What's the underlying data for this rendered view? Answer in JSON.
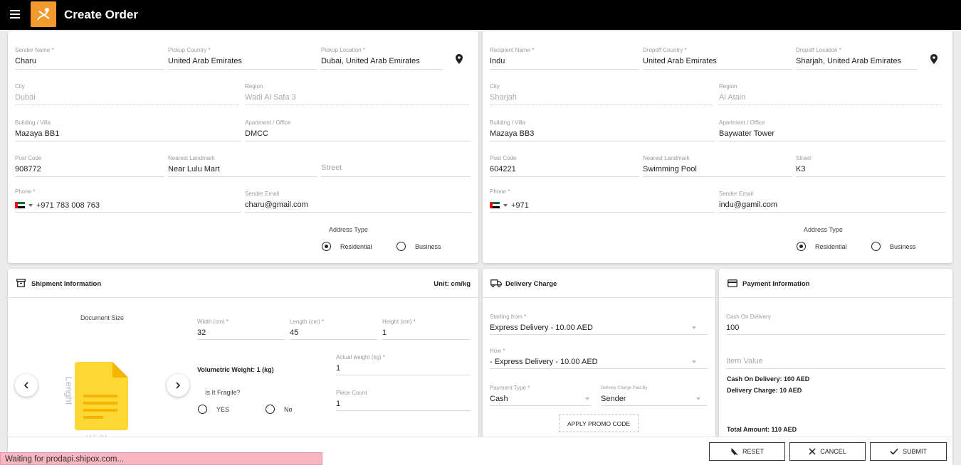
{
  "app": {
    "title": "Create Order"
  },
  "sender": {
    "name_label": "Sender Name *",
    "name": "Charu",
    "country_label": "Pickup Country *",
    "country": "United Arab Emirates",
    "location_label": "Pickup Location *",
    "location": "Dubai, United Arab Emirates",
    "city_label": "City",
    "city": "Dubai",
    "region_label": "Region",
    "region": "Wadi Al Safa 3",
    "building_label": "Building / Villa",
    "building": "Mazaya BB1",
    "apartment_label": "Apartment / Office",
    "apartment": "DMCC",
    "postcode_label": "Post Code",
    "postcode": "908772",
    "landmark_label": "Nearest Landmark",
    "landmark": "Near Lulu Mart",
    "street_placeholder": "Street",
    "phone_label": "Phone *",
    "phone": "+971 783 008 763",
    "email_label": "Sender Email",
    "email": "charu@gmail.com",
    "address_type_label": "Address Type",
    "residential_label": "Residential",
    "business_label": "Business",
    "address_type_selected": "Residential"
  },
  "recipient": {
    "name_label": "Recipient Name *",
    "name": "Indu",
    "country_label": "Dropoff Country *",
    "country": "United Arab Emirates",
    "location_label": "Dropoff Location *",
    "location": "Sharjah, United Arab Emirates",
    "city_label": "City",
    "city": "Sharjah",
    "region_label": "Region",
    "region": "Al Atain",
    "building_label": "Building / Villa",
    "building": "Mazaya BB3",
    "apartment_label": "Apartment / Office",
    "apartment": "Baywater Tower",
    "postcode_label": "Post Code",
    "postcode": "604221",
    "landmark_label": "Nearest Landmark",
    "landmark": "Swimming Pool",
    "street_label": "Street",
    "street": "K3",
    "phone_label": "Phone *",
    "phone": "+971",
    "email_label": "Sender Email",
    "email": "indu@gamil.com",
    "address_type_label": "Address Type",
    "residential_label": "Residential",
    "business_label": "Business",
    "address_type_selected": "Residential"
  },
  "shipment": {
    "title": "Shipment Information",
    "unit": "Unit: cm/kg",
    "document_size": "Document Size",
    "lenght_label": "Lenght",
    "width_caption": "Width",
    "width_label": "Width (cm) *",
    "width": "32",
    "length_label": "Length (cm) *",
    "length": "45",
    "height_label": "Height (cm) *",
    "height": "1",
    "volumetric": "Volumetric Weight: 1 (kg)",
    "actual_weight_label": "Actual weight (kg) *",
    "actual_weight": "1",
    "fragile_label": "Is It Fragile?",
    "yes_label": "YES",
    "no_label": "No",
    "piece_count_label": "Piece Count",
    "piece_count": "1"
  },
  "delivery": {
    "title": "Delivery Charge",
    "starting_label": "Starting from *",
    "starting": "Express Delivery - 10.00 AED",
    "how_label": "How *",
    "how": "- Express Delivery - 10.00 AED",
    "payment_type_label": "Payment Type *",
    "payment_type": "Cash",
    "paid_by_label": "Delivery Charge Paid By",
    "paid_by": "Sender",
    "promo_button": "APPLY PROMO CODE"
  },
  "payment": {
    "title": "Payment Information",
    "cod_label": "Cash On Delivery",
    "cod": "100",
    "item_value_placeholder": "Item Value",
    "cod_summary": "Cash On Delivery: 100 AED",
    "delivery_summary": "Delivery Charge: 10 AED",
    "total": "Total Amount: 110 AED"
  },
  "actions": {
    "reset": "RESET",
    "cancel": "CANCEL",
    "submit": "SUBMIT"
  },
  "status_bar": {
    "text": "Waiting for prodapi.shipox.com..."
  },
  "colors": {
    "brand": "#f39a2e",
    "appbar": "#000000",
    "status": "#f7b6c1",
    "doc_icon": "#fdd835"
  }
}
